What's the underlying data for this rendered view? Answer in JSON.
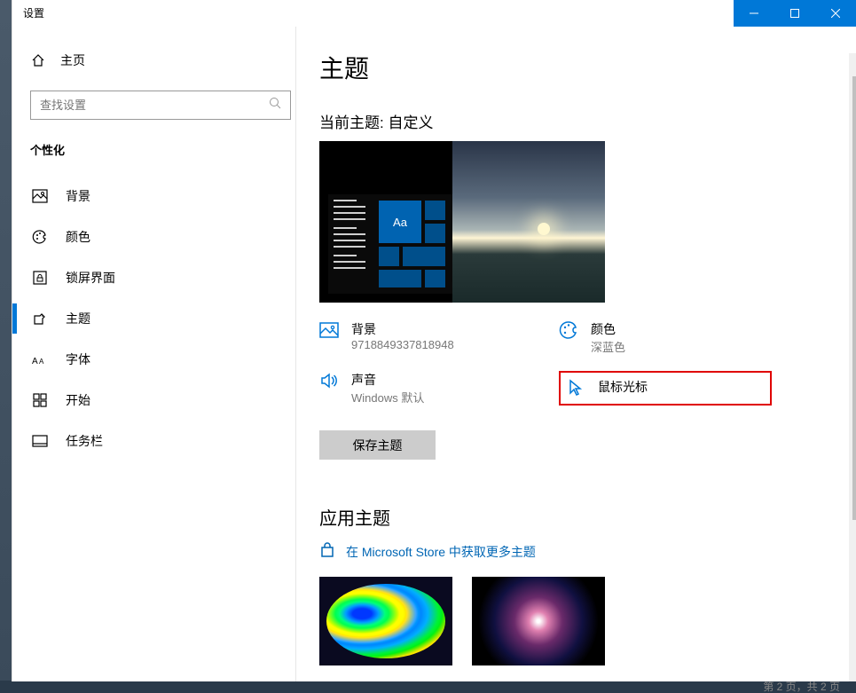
{
  "window": {
    "title": "设置"
  },
  "home": {
    "label": "主页"
  },
  "search": {
    "placeholder": "查找设置"
  },
  "section": {
    "title": "个性化"
  },
  "nav": [
    {
      "label": "背景"
    },
    {
      "label": "颜色"
    },
    {
      "label": "锁屏界面"
    },
    {
      "label": "主题"
    },
    {
      "label": "字体"
    },
    {
      "label": "开始"
    },
    {
      "label": "任务栏"
    }
  ],
  "page": {
    "title": "主题",
    "currentTheme": "当前主题: 自定义",
    "previewTileText": "Aa"
  },
  "settings": {
    "bg": {
      "title": "背景",
      "value": "9718849337818948"
    },
    "color": {
      "title": "颜色",
      "value": "深蓝色"
    },
    "sound": {
      "title": "声音",
      "value": "Windows 默认"
    },
    "cursor": {
      "title": "鼠标光标",
      "value": ""
    }
  },
  "saveButton": "保存主题",
  "apply": {
    "heading": "应用主题",
    "storeLink": "在 Microsoft Store 中获取更多主题"
  },
  "pager": "第 2 页，共 2 页"
}
